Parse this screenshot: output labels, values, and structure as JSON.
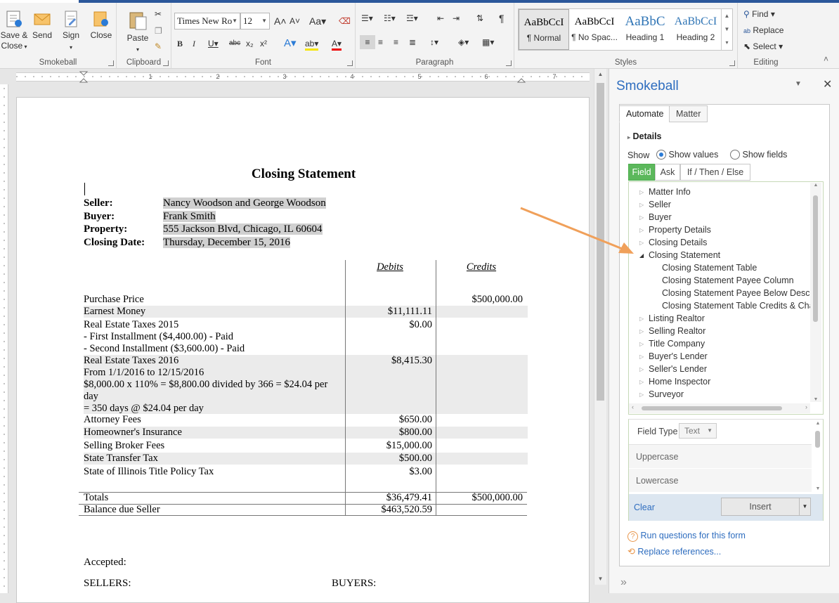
{
  "ribbon": {
    "groups": {
      "smokeball": "Smokeball",
      "clipboard": "Clipboard",
      "font": "Font",
      "paragraph": "Paragraph",
      "styles": "Styles",
      "editing": "Editing"
    },
    "save_close_line1": "Save &",
    "save_close_line2": "Close",
    "send": "Send",
    "sign": "Sign",
    "close": "Close",
    "paste": "Paste",
    "font_name": "Times New Ro",
    "font_size": "12",
    "styles": [
      {
        "sample": "AaBbCcI",
        "name": "¶ Normal"
      },
      {
        "sample": "AaBbCcI",
        "name": "¶ No Spac..."
      },
      {
        "sample": "AaBbC",
        "name": "Heading 1"
      },
      {
        "sample": "AaBbCcI",
        "name": "Heading 2"
      }
    ],
    "find": "Find",
    "replace": "Replace",
    "select": "Select"
  },
  "document": {
    "title": "Closing Statement",
    "labels": {
      "seller": "Seller:",
      "buyer": "Buyer:",
      "property": "Property:",
      "closing_date": "Closing Date:"
    },
    "values": {
      "seller": "Nancy Woodson and George Woodson",
      "buyer": "Frank Smith",
      "property": "555 Jackson Blvd, Chicago, IL 60604",
      "closing_date": "Thursday, December 15, 2016"
    },
    "col_debits": "Debits",
    "col_credits": "Credits",
    "rows": [
      {
        "desc": "Purchase Price",
        "debit": "",
        "credit": "$500,000.00"
      },
      {
        "desc": "Earnest Money",
        "debit": "$11,111.11",
        "credit": ""
      },
      {
        "desc": "Real Estate Taxes 2015",
        "debit": "$0.00",
        "credit": ""
      },
      {
        "desc": "- First Installment ($4,400.00) - Paid",
        "debit": "",
        "credit": ""
      },
      {
        "desc": "- Second Installment ($3,600.00) - Paid",
        "debit": "",
        "credit": ""
      },
      {
        "desc": "Real Estate Taxes 2016",
        "debit": "$8,415.30",
        "credit": ""
      },
      {
        "desc": "From 1/1/2016 to 12/15/2016",
        "debit": "",
        "credit": ""
      },
      {
        "desc": "$8,000.00 x 110% = $8,800.00 divided by 366 = $24.04 per",
        "debit": "",
        "credit": ""
      },
      {
        "desc": "day",
        "debit": "",
        "credit": ""
      },
      {
        "desc": "= 350 days @ $24.04 per day",
        "debit": "",
        "credit": ""
      },
      {
        "desc": "Attorney Fees",
        "debit": "$650.00",
        "credit": ""
      },
      {
        "desc": "Homeowner's Insurance",
        "debit": "$800.00",
        "credit": ""
      },
      {
        "desc": "Selling Broker Fees",
        "debit": "$15,000.00",
        "credit": ""
      },
      {
        "desc": "State Transfer Tax",
        "debit": "$500.00",
        "credit": ""
      },
      {
        "desc": "State of Illinois Title Policy Tax",
        "debit": "$3.00",
        "credit": ""
      }
    ],
    "totals": {
      "desc": "Totals",
      "debit": "$36,479.41",
      "credit": "$500,000.00"
    },
    "balance": {
      "desc": "Balance due Seller",
      "debit": "$463,520.59"
    },
    "accepted": "Accepted:",
    "sellers": "SELLERS:",
    "buyers": "BUYERS:"
  },
  "pane": {
    "title": "Smokeball",
    "tabs": [
      "Automate",
      "Matter"
    ],
    "details": "Details",
    "show_label": "Show",
    "show_values": "Show values",
    "show_fields": "Show fields",
    "subtabs": [
      "Field",
      "Ask",
      "If / Then / Else"
    ],
    "tree": [
      {
        "label": "Matter Info",
        "level": 0,
        "expanded": false
      },
      {
        "label": "Seller",
        "level": 0,
        "expanded": false
      },
      {
        "label": "Buyer",
        "level": 0,
        "expanded": false
      },
      {
        "label": "Property Details",
        "level": 0,
        "expanded": false
      },
      {
        "label": "Closing Details",
        "level": 0,
        "expanded": false
      },
      {
        "label": "Closing Statement",
        "level": 0,
        "expanded": true
      },
      {
        "label": "Closing Statement Table",
        "level": 1
      },
      {
        "label": "Closing Statement Payee Column",
        "level": 1
      },
      {
        "label": "Closing Statement Payee Below Descrip",
        "level": 1
      },
      {
        "label": "Closing Statement Table Credits & Cha",
        "level": 1
      },
      {
        "label": "Listing Realtor",
        "level": 0,
        "expanded": false
      },
      {
        "label": "Selling Realtor",
        "level": 0,
        "expanded": false
      },
      {
        "label": "Title Company",
        "level": 0,
        "expanded": false
      },
      {
        "label": "Buyer's Lender",
        "level": 0,
        "expanded": false
      },
      {
        "label": "Seller's Lender",
        "level": 0,
        "expanded": false
      },
      {
        "label": "Home Inspector",
        "level": 0,
        "expanded": false
      },
      {
        "label": "Surveyor",
        "level": 0,
        "expanded": false
      }
    ],
    "field_type_label": "Field Type",
    "field_type_value": "Text",
    "options": [
      "Uppercase",
      "Lowercase"
    ],
    "clear": "Clear",
    "insert": "Insert",
    "run_questions": "Run questions for this form",
    "replace_refs": "Replace references...",
    "colors": {
      "accent_blue": "#2e6dbf",
      "tab_green": "#5cb85c",
      "link_blue": "#2e6dbf",
      "arrow_orange": "#f0a05a"
    }
  }
}
